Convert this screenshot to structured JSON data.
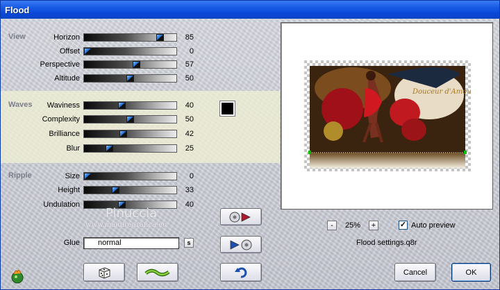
{
  "window": {
    "title": "Flood"
  },
  "sections": {
    "view": {
      "label": "View",
      "rows": [
        {
          "label": "Horizon",
          "value": "85",
          "level": 0.85
        },
        {
          "label": "Offset",
          "value": "0",
          "level": 0.0
        },
        {
          "label": "Perspective",
          "value": "57",
          "level": 0.57
        },
        {
          "label": "Altitude",
          "value": "50",
          "level": 0.5
        }
      ]
    },
    "waves": {
      "label": "Waves",
      "rows": [
        {
          "label": "Waviness",
          "value": "40",
          "level": 0.4
        },
        {
          "label": "Complexity",
          "value": "50",
          "level": 0.5
        },
        {
          "label": "Brilliance",
          "value": "42",
          "level": 0.42
        },
        {
          "label": "Blur",
          "value": "25",
          "level": 0.25
        }
      ],
      "color": "#000000"
    },
    "ripple": {
      "label": "Ripple",
      "rows": [
        {
          "label": "Size",
          "value": "0",
          "level": 0.0
        },
        {
          "label": "Height",
          "value": "33",
          "level": 0.33
        },
        {
          "label": "Undulation",
          "value": "40",
          "level": 0.4
        }
      ]
    }
  },
  "glue": {
    "label": "Glue",
    "value": "normal",
    "s_label": "s"
  },
  "watermark": {
    "name": "Pinuccia",
    "url": "www.maidiregrafica.eu"
  },
  "preview": {
    "image_text": "Douceur d'Amour"
  },
  "zoom": {
    "minus": "-",
    "value": "25%",
    "plus": "+"
  },
  "auto_preview": {
    "label": "Auto preview",
    "checked": true,
    "mark": "✓"
  },
  "settings_file": "Flood settings.q8r",
  "buttons": {
    "cancel": "Cancel",
    "ok": "OK"
  },
  "colors": {
    "titlebar": "#0a48d8",
    "slider_thumb": "#1d64c8",
    "waves_band": "#eeeed4"
  }
}
